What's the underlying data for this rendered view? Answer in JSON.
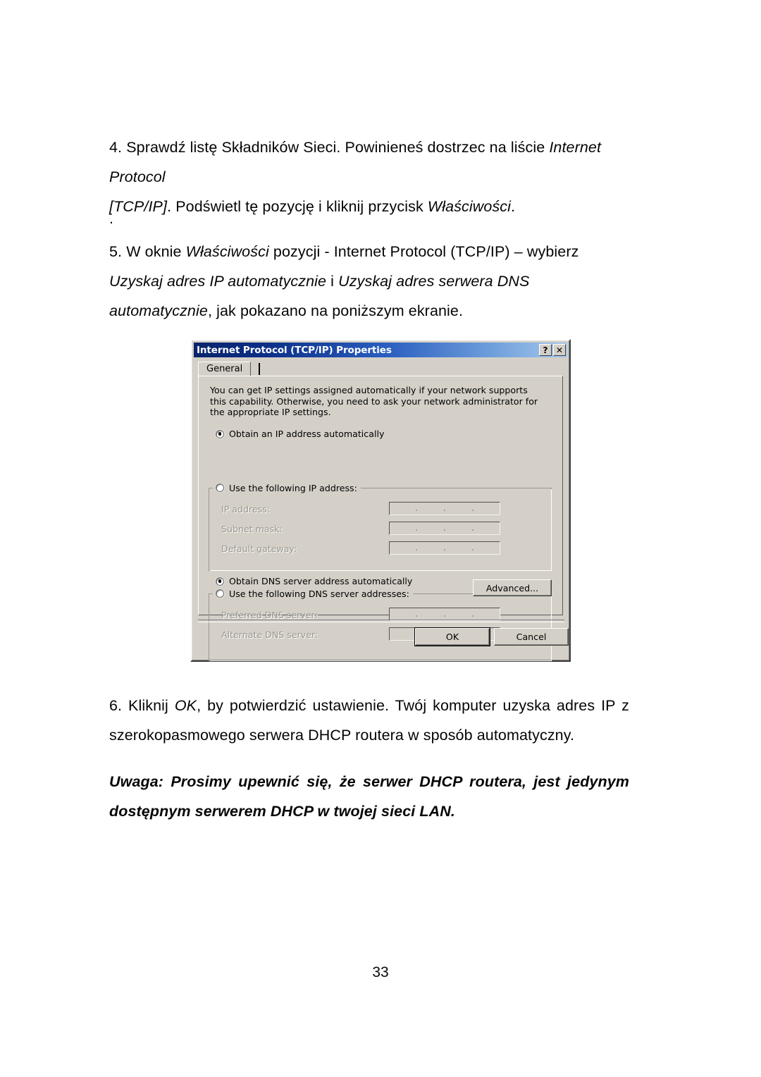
{
  "document": {
    "page_number": "33",
    "paragraphs": {
      "step4": {
        "line1_pre": "4. ",
        "line1_a": "Sprawdź listę Składników Sieci. Powinieneś dostrzec na liście ",
        "line1_italic": "Internet Protocol",
        "line2_italic_a": "[TCP/IP]",
        "line2_plain": ". Podświetl tę pozycję i kliknij przycisk ",
        "line2_italic_b": "Właściwości",
        "line2_end": "."
      },
      "stray_dot": ".",
      "step5": {
        "pre": "5. W oknie ",
        "i1": "Właściwości",
        "t1": " pozycji - Internet Protocol (TCP/IP) – wybierz ",
        "i2": "Uzyskaj adres IP automatycznie",
        "t2": " i ",
        "i3": "Uzyskaj adres serwera DNS automatycznie",
        "t3": ", jak pokazano na poniższym ekranie."
      },
      "step6": {
        "pre": "6. Kliknij ",
        "i1": "OK",
        "t1": ", by potwierdzić ustawienie. Twój komputer uzyska adres IP z szerokopasmowego serwera DHCP routera w sposób automatyczny."
      },
      "note": "Uwaga: Prosimy upewnić się, że serwer DHCP routera, jest jedynym dostępnym serwerem DHCP w twojej sieci LAN."
    }
  },
  "dialog": {
    "title": "Internet Protocol (TCP/IP) Properties",
    "help_button": "?",
    "close_button": "✕",
    "tab_general": "General",
    "description": "You can get IP settings assigned automatically if your network supports this capability. Otherwise, you need to ask your network administrator for the appropriate IP settings.",
    "ip": {
      "obtain_auto_label": "Obtain an IP address automatically",
      "obtain_auto_selected": true,
      "use_following_label": "Use the following IP address:",
      "use_following_selected": false,
      "fields": [
        {
          "label": "IP address:",
          "value": ""
        },
        {
          "label": "Subnet mask:",
          "value": ""
        },
        {
          "label": "Default gateway:",
          "value": ""
        }
      ]
    },
    "dns": {
      "obtain_auto_label": "Obtain DNS server address automatically",
      "obtain_auto_selected": true,
      "use_following_label": "Use the following DNS server addresses:",
      "use_following_selected": false,
      "fields": [
        {
          "label": "Preferred DNS server:",
          "value": ""
        },
        {
          "label": "Alternate DNS server:",
          "value": ""
        }
      ]
    },
    "buttons": {
      "advanced": "Advanced...",
      "ok": "OK",
      "cancel": "Cancel"
    },
    "colors": {
      "face": "#d4d0c8",
      "title_left": "#0a246a",
      "title_right": "#a6c8ec",
      "disabled_text": "#9b9790"
    }
  }
}
